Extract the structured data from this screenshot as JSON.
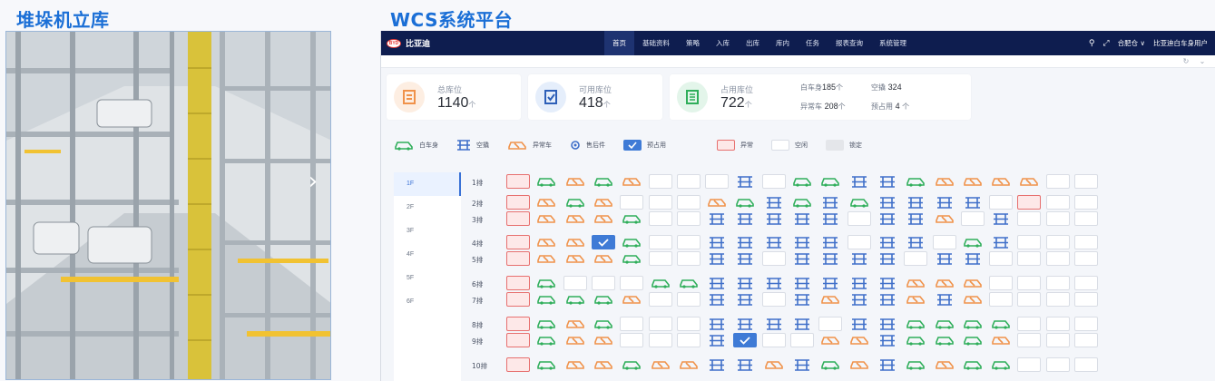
{
  "titles": {
    "left": "堆垛机立库",
    "right": "WCS系统平台"
  },
  "photo": {
    "next_icon": "chevron-right-icon"
  },
  "app": {
    "logo_text": "比亚迪",
    "menu": [
      "首页",
      "基础资料",
      "策略",
      "入库",
      "出库",
      "库内",
      "任务",
      "报表查询",
      "系统管理"
    ],
    "active_menu": 0,
    "top_right": {
      "location": "合肥仓 ∨",
      "user": "比亚迪白车身用户"
    },
    "stats": {
      "total": {
        "label": "总库位",
        "value": "1140",
        "unit": "个"
      },
      "available": {
        "label": "可用库位",
        "value": "418",
        "unit": "个"
      },
      "occupied": {
        "label": "占用库位",
        "value": "722",
        "unit": "个"
      },
      "extra": [
        {
          "label": "白车身",
          "value": "185",
          "unit": "个"
        },
        {
          "label": "空撬",
          "value": "324",
          "unit": ""
        },
        {
          "label": "异常车",
          "value": "208",
          "unit": "个"
        },
        {
          "label": "预占用",
          "value": "4",
          "unit": "个"
        }
      ]
    },
    "legend": {
      "items": [
        "白车身",
        "空撬",
        "异常车",
        "售后件",
        "预占用"
      ],
      "boxes": [
        "异常",
        "空闲",
        "锁定"
      ]
    },
    "floors": [
      "1F",
      "2F",
      "3F",
      "4F",
      "5F",
      "6F"
    ],
    "active_floor": 0,
    "colors": {
      "car": "#2fae5a",
      "shelf": "#3f6fc9",
      "wrench": "#f0924a",
      "abnormal": "#e7706f",
      "nav": "#0e1d4f"
    },
    "rows": [
      {
        "label": "1排",
        "cells": "ACWCWEEESECCSSCWWWWEE"
      },
      {
        "label": "2排",
        "cells": "AWCWEEEWCSCSCSSSSEAEE"
      },
      {
        "label": "3排",
        "cells": "AWWWCEESSSSSESSWESEEE"
      },
      {
        "label": "4排",
        "cells": "AWWPCEESSSSSESSECSEEE"
      },
      {
        "label": "5排",
        "cells": "AWWWCEESSESSSSESSEEEE"
      },
      {
        "label": "6排",
        "cells": "ACEEECCSSSSSSSWWWEEEE"
      },
      {
        "label": "7排",
        "cells": "ACCCWEESSESWSSWSWEEEE"
      },
      {
        "label": "8排",
        "cells": "ACWCEEESSSSESSCCCCEEE"
      },
      {
        "label": "9排",
        "cells": "ACWWEEESPEEWWSCCCWEEE"
      },
      {
        "label": "10排",
        "cells": "ACWWCWWSSWSCWSCWCCEEE"
      }
    ]
  }
}
